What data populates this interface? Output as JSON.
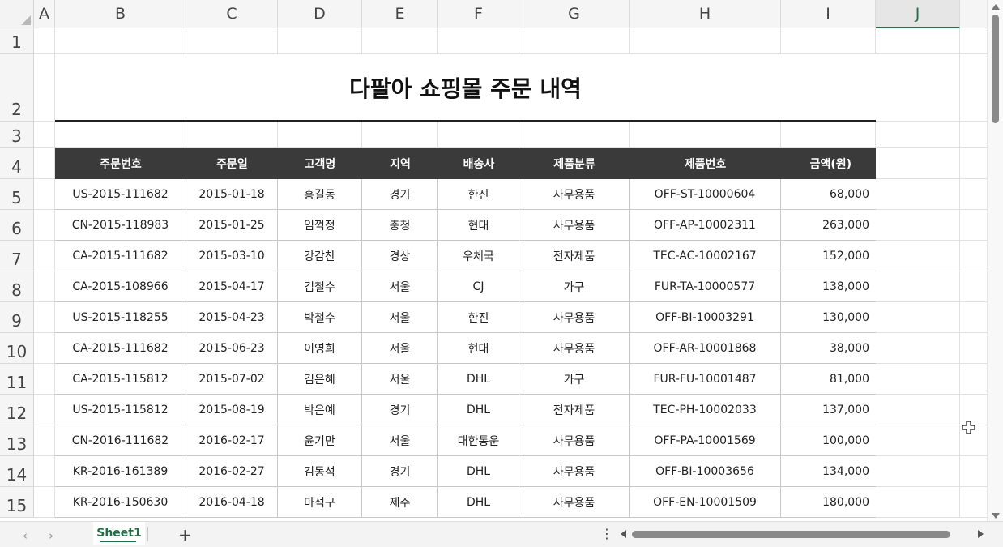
{
  "columns": [
    "A",
    "B",
    "C",
    "D",
    "E",
    "F",
    "G",
    "H",
    "I",
    "J"
  ],
  "rows": [
    "1",
    "2",
    "3",
    "4",
    "5",
    "6",
    "7",
    "8",
    "9",
    "10",
    "11",
    "12",
    "13",
    "14",
    "15"
  ],
  "selected_column": "J",
  "title": "다팔아 쇼핑몰 주문 내역",
  "table": {
    "headers": [
      "주문번호",
      "주문일",
      "고객명",
      "지역",
      "배송사",
      "제품분류",
      "제품번호",
      "금액(원)"
    ],
    "rows": [
      [
        "US-2015-111682",
        "2015-01-18",
        "홍길동",
        "경기",
        "한진",
        "사무용품",
        "OFF-ST-10000604",
        "68,000"
      ],
      [
        "CN-2015-118983",
        "2015-01-25",
        "임꺽정",
        "충청",
        "현대",
        "사무용품",
        "OFF-AP-10002311",
        "263,000"
      ],
      [
        "CA-2015-111682",
        "2015-03-10",
        "강감찬",
        "경상",
        "우체국",
        "전자제품",
        "TEC-AC-10002167",
        "152,000"
      ],
      [
        "CA-2015-108966",
        "2015-04-17",
        "김철수",
        "서울",
        "CJ",
        "가구",
        "FUR-TA-10000577",
        "138,000"
      ],
      [
        "US-2015-118255",
        "2015-04-23",
        "박철수",
        "서울",
        "한진",
        "사무용품",
        "OFF-BI-10003291",
        "130,000"
      ],
      [
        "CA-2015-111682",
        "2015-06-23",
        "이영희",
        "서울",
        "현대",
        "사무용품",
        "OFF-AR-10001868",
        "38,000"
      ],
      [
        "CA-2015-115812",
        "2015-07-02",
        "김은혜",
        "서울",
        "DHL",
        "가구",
        "FUR-FU-10001487",
        "81,000"
      ],
      [
        "US-2015-115812",
        "2015-08-19",
        "박은예",
        "경기",
        "DHL",
        "전자제품",
        "TEC-PH-10002033",
        "137,000"
      ],
      [
        "CN-2016-111682",
        "2016-02-17",
        "윤기만",
        "서울",
        "대한통운",
        "사무용품",
        "OFF-PA-10001569",
        "100,000"
      ],
      [
        "KR-2016-161389",
        "2016-02-27",
        "김동석",
        "경기",
        "DHL",
        "사무용품",
        "OFF-BI-10003656",
        "134,000"
      ],
      [
        "KR-2016-150630",
        "2016-04-18",
        "마석구",
        "제주",
        "DHL",
        "사무용품",
        "OFF-EN-10001509",
        "180,000"
      ]
    ]
  },
  "sheet_tab": "Sheet1",
  "add_sheet_label": "+",
  "more_label": "⋮",
  "nav_prev": "‹",
  "nav_next": "›",
  "colors": {
    "header_bg": "#3a3a3a",
    "accent": "#1e7145"
  }
}
